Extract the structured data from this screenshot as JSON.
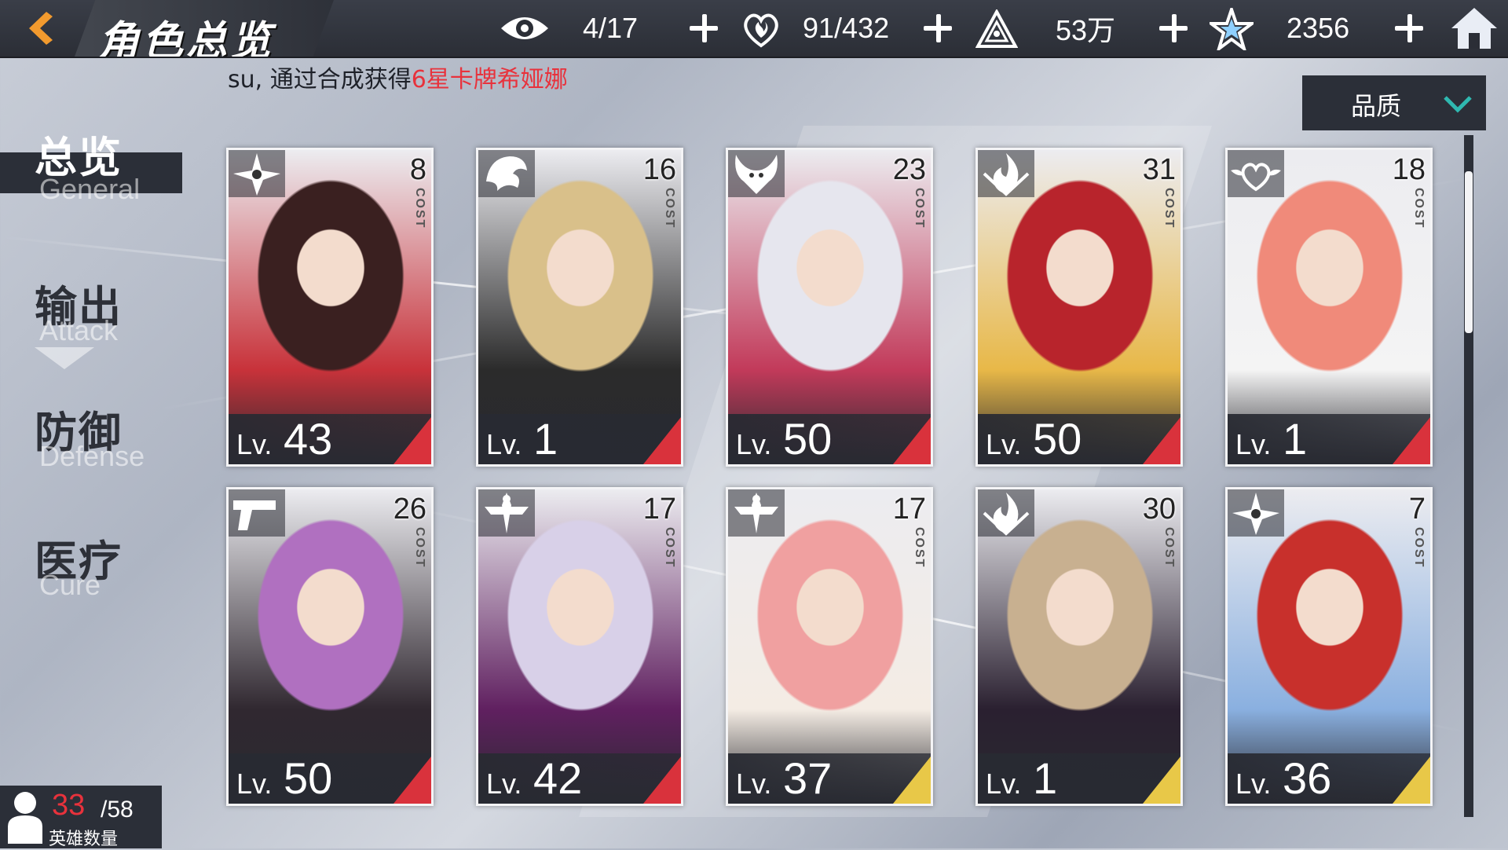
{
  "header": {
    "title": "角色总览",
    "resources": [
      {
        "icon": "eye-icon",
        "value": "4/17"
      },
      {
        "icon": "heart-fire-icon",
        "value": "91/432"
      },
      {
        "icon": "triangle-emblem-icon",
        "value": "53万"
      },
      {
        "icon": "star-crystal-icon",
        "value": "2356"
      }
    ]
  },
  "ticker": {
    "prefix": "su, 通过合成获得",
    "highlight": "6星卡牌希娅娜"
  },
  "sort": {
    "label": "品质"
  },
  "sidebar": {
    "tabs": [
      {
        "zh": "总览",
        "en": "General"
      },
      {
        "zh": "输出",
        "en": "Attack"
      },
      {
        "zh": "防御",
        "en": "Defense"
      },
      {
        "zh": "医疗",
        "en": "Cure"
      }
    ]
  },
  "cards": [
    {
      "lv_prefix": "Lv.",
      "level": "43",
      "cost": "8",
      "cost_label": "COST",
      "class_icon": "shuriken-icon",
      "accent": "#d9323c"
    },
    {
      "lv_prefix": "Lv.",
      "level": "1",
      "cost": "16",
      "cost_label": "COST",
      "class_icon": "dragon-icon",
      "accent": "#d9323c"
    },
    {
      "lv_prefix": "Lv.",
      "level": "50",
      "cost": "23",
      "cost_label": "COST",
      "class_icon": "demon-icon",
      "accent": "#d9323c"
    },
    {
      "lv_prefix": "Lv.",
      "level": "50",
      "cost": "31",
      "cost_label": "COST",
      "class_icon": "flame-icon",
      "accent": "#d9323c"
    },
    {
      "lv_prefix": "Lv.",
      "level": "1",
      "cost": "18",
      "cost_label": "COST",
      "class_icon": "heart-wing-icon",
      "accent": "#d9323c"
    },
    {
      "lv_prefix": "Lv.",
      "level": "50",
      "cost": "26",
      "cost_label": "COST",
      "class_icon": "gun-icon",
      "accent": "#d9323c"
    },
    {
      "lv_prefix": "Lv.",
      "level": "42",
      "cost": "17",
      "cost_label": "COST",
      "class_icon": "sword-crest-icon",
      "accent": "#d9323c"
    },
    {
      "lv_prefix": "Lv.",
      "level": "37",
      "cost": "17",
      "cost_label": "COST",
      "class_icon": "sword-crest-icon",
      "accent": "#e8c848"
    },
    {
      "lv_prefix": "Lv.",
      "level": "1",
      "cost": "30",
      "cost_label": "COST",
      "class_icon": "flame-icon",
      "accent": "#e8c848"
    },
    {
      "lv_prefix": "Lv.",
      "level": "36",
      "cost": "7",
      "cost_label": "COST",
      "class_icon": "shuriken-icon",
      "accent": "#e8c848"
    }
  ],
  "hero_count": {
    "current": "33",
    "total": "/58",
    "label": "英雄数量"
  },
  "colors": {
    "accent_red": "#e8323c",
    "panel_dark": "#2b2f38",
    "highlight_teal": "#2fb8b0"
  }
}
